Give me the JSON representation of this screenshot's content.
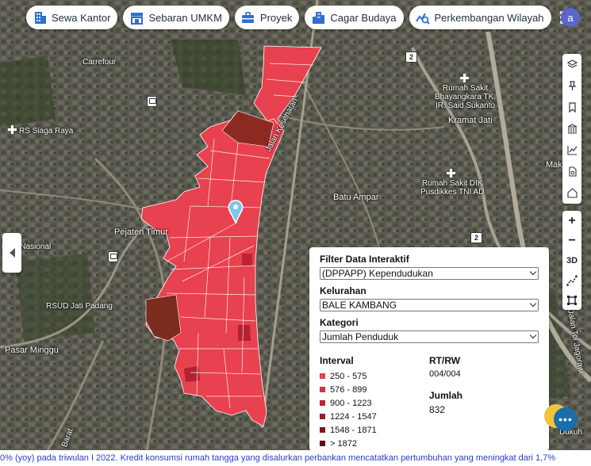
{
  "nav": {
    "chips": [
      {
        "label": "Sewa Kantor",
        "icon": "building-icon"
      },
      {
        "label": "Sebaran UMKM",
        "icon": "store-icon"
      },
      {
        "label": "Proyek",
        "icon": "briefcase-icon"
      },
      {
        "label": "Cagar Budaya",
        "icon": "city-icon"
      },
      {
        "label": "Perkembangan Wilayah",
        "icon": "chart-search-icon"
      }
    ],
    "apps_icon": "grid-icon",
    "avatar_letter": "a"
  },
  "map": {
    "labels": {
      "carrefour": "Carrefour",
      "rs_siaga_raya": "RS Siaga Raya",
      "rs_bhayangkara": "Rumah Sakit\nBhayangkara TK.\nIR. Said Sukanto",
      "kramat_jati": "Kramat Jati",
      "rs_dik": "Rumah Sakit DIK\nPusdikkes TNI AD",
      "batu_ampar": "Batu Ampar",
      "pejaten_timur": "Pejaten Timur",
      "sitas_nasional": "sitas Nasional",
      "rsud_jati_padang": "RSUD Jati Padang",
      "pasar_minggu": "Pasar Minggu",
      "jalan_kesehatan": "Jalan Kesehatan",
      "mak": "Mak",
      "dukuh": "Dukuh",
      "tol_jagorawi": "Jalan Tol Jagorawi",
      "barat": "Barat",
      "road_2a": "2",
      "road_2b": "2"
    }
  },
  "filter_panel": {
    "title": "Filter Data Interaktif",
    "dataset_value": "(DPPAPP) Kependudukan",
    "kelurahan_label": "Kelurahan",
    "kelurahan_value": "BALE KAMBANG",
    "kategori_label": "Kategori",
    "kategori_value": "Jumlah Penduduk",
    "legend_title": "Interval",
    "legend": [
      {
        "label": "250 - 575",
        "color": "#e8404e"
      },
      {
        "label": "576 - 899",
        "color": "#d2343f"
      },
      {
        "label": "900 - 1223",
        "color": "#b82531"
      },
      {
        "label": "1224 - 1547",
        "color": "#9a1c2a"
      },
      {
        "label": "1548 - 1871",
        "color": "#7d1621"
      },
      {
        "label": "> 1872",
        "color": "#5c1015"
      }
    ],
    "rtrw_label": "RT/RW",
    "rtrw_value": "004/004",
    "jumlah_label": "Jumlah",
    "jumlah_value": "832"
  },
  "ticker": {
    "text": "0% (yoy) pada triwulan I 2022. Kredit konsumsi rumah tangga yang disalurkan perbankan mencatatkan pertumbuhan yang meningkat dari 1,7%"
  },
  "colors": {
    "choropleth_main": "#e8414f",
    "choropleth_dark": "#8c2a22",
    "chip_icon": "#2f6fd1"
  }
}
